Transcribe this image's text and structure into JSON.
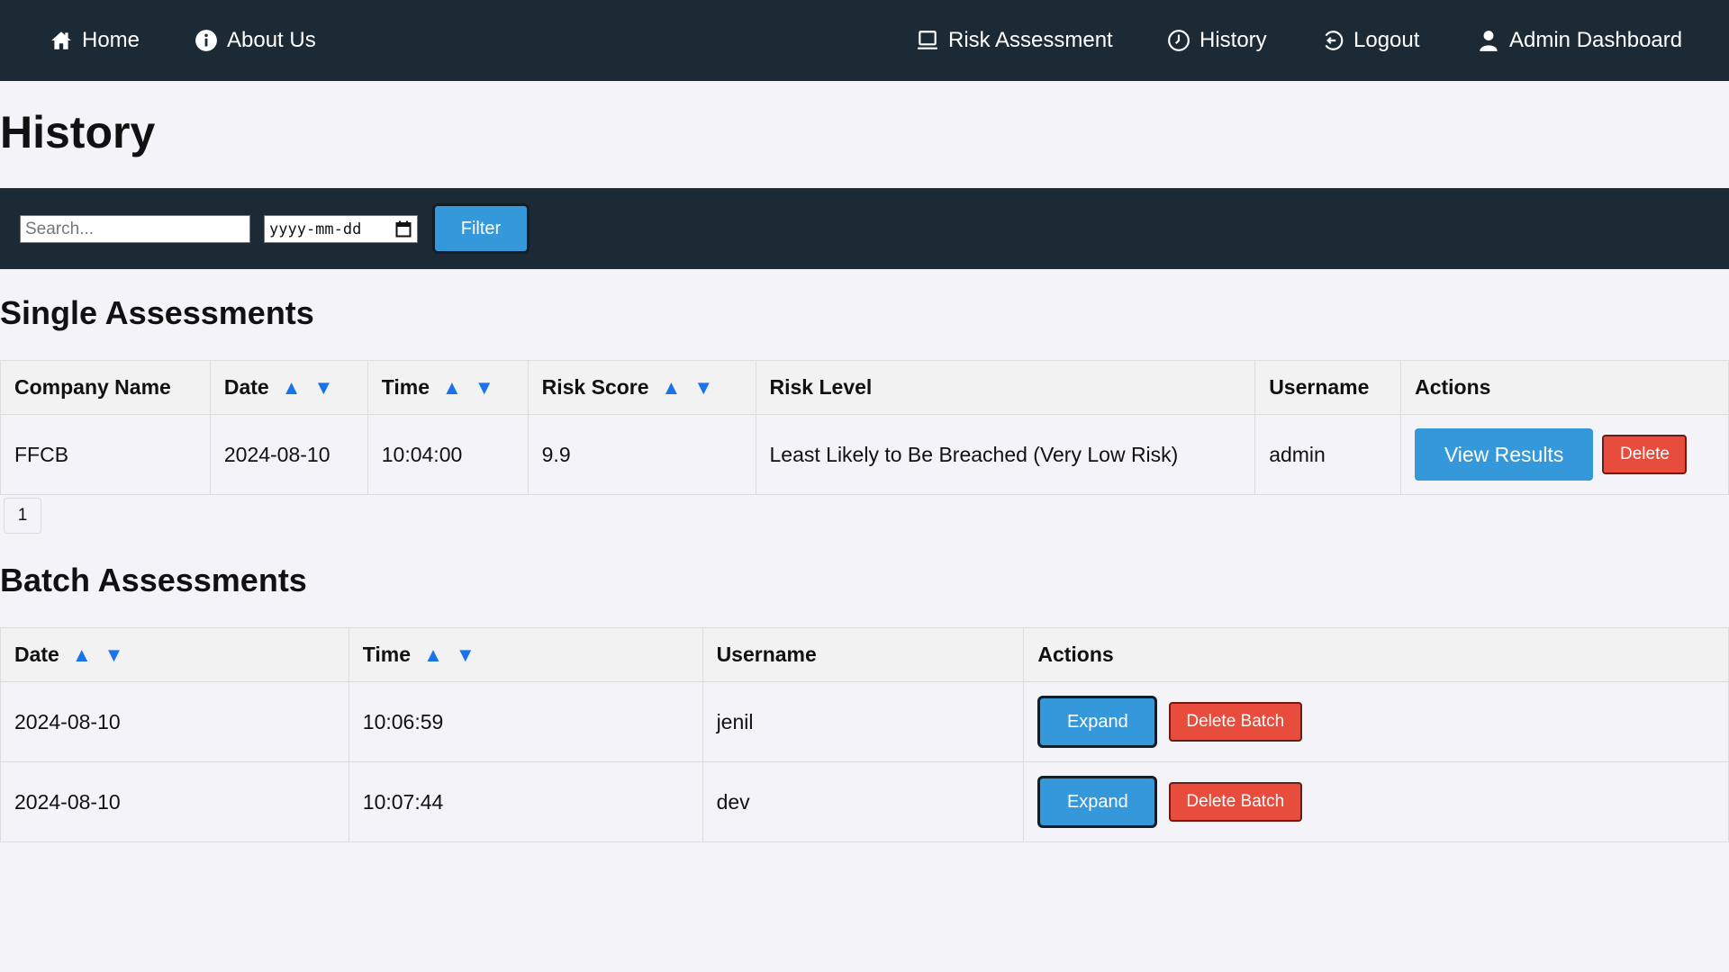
{
  "nav": {
    "left": [
      {
        "label": "Home",
        "icon": "home-icon"
      },
      {
        "label": "About Us",
        "icon": "info-icon"
      }
    ],
    "right": [
      {
        "label": "Risk Assessment",
        "icon": "laptop-icon"
      },
      {
        "label": "History",
        "icon": "clock-icon"
      },
      {
        "label": "Logout",
        "icon": "logout-icon"
      },
      {
        "label": "Admin Dashboard",
        "icon": "user-icon"
      }
    ]
  },
  "page": {
    "title": "History"
  },
  "filter": {
    "search_placeholder": "Search...",
    "date_placeholder": "yyyy-mm-dd",
    "button_label": "Filter"
  },
  "single": {
    "heading": "Single Assessments",
    "columns": [
      "Company Name",
      "Date",
      "Time",
      "Risk Score",
      "Risk Level",
      "Username",
      "Actions"
    ],
    "sort_up": "▲",
    "sort_down": "▼",
    "rows": [
      {
        "company": "FFCB",
        "date": "2024-08-10",
        "time": "10:04:00",
        "risk_score": "9.9",
        "risk_level": "Least Likely to Be Breached (Very Low Risk)",
        "username": "admin",
        "view_label": "View Results",
        "delete_label": "Delete"
      }
    ],
    "page_number": "1"
  },
  "batch": {
    "heading": "Batch Assessments",
    "columns": [
      "Date",
      "Time",
      "Username",
      "Actions"
    ],
    "rows": [
      {
        "date": "2024-08-10",
        "time": "10:06:59",
        "username": "jenil",
        "expand_label": "Expand",
        "delete_label": "Delete Batch"
      },
      {
        "date": "2024-08-10",
        "time": "10:07:44",
        "username": "dev",
        "expand_label": "Expand",
        "delete_label": "Delete Batch"
      }
    ]
  },
  "colors": {
    "navbar": "#1b2a34",
    "primary_button": "#3498db",
    "danger_button": "#e74c3c",
    "sort_arrow": "#1a73e8",
    "background": "#f4f4f8"
  }
}
